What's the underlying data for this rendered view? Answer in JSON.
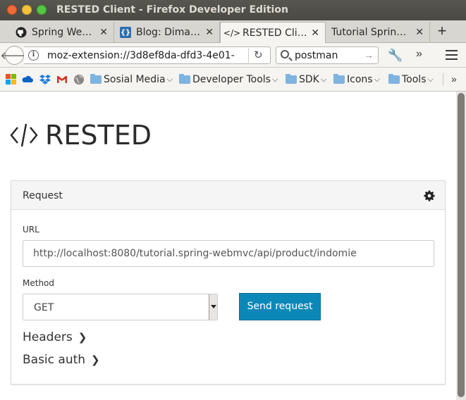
{
  "window": {
    "title": "RESTED Client - Firefox Developer Edition"
  },
  "tabs": [
    {
      "label": "Spring We…",
      "favicon": "github-icon"
    },
    {
      "label": "Blog: Dima…",
      "favicon": "blog-icon"
    },
    {
      "label": "RESTED Cli…",
      "favicon": "code-icon",
      "active": true
    },
    {
      "label": "Tutorial Sprin…",
      "favicon": "none"
    }
  ],
  "navbar": {
    "url": "moz-extension://3d8ef8da-dfd3-4e01-",
    "search_value": "postman"
  },
  "bookmarks": [
    {
      "label": "Sosial Media"
    },
    {
      "label": "Developer Tools"
    },
    {
      "label": "SDK"
    },
    {
      "label": "Icons"
    },
    {
      "label": "Tools"
    }
  ],
  "app": {
    "logo_text": "RESTED",
    "panel_title": "Request",
    "url_label": "URL",
    "url_value": "http://localhost:8080/tutorial.spring-webmvc/api/product/indomie",
    "method_label": "Method",
    "method_value": "GET",
    "send_label": "Send request",
    "headers_label": "Headers",
    "basic_auth_label": "Basic auth"
  },
  "colors": {
    "accent": "#0c88b8",
    "titlebar": "#4a4943"
  }
}
